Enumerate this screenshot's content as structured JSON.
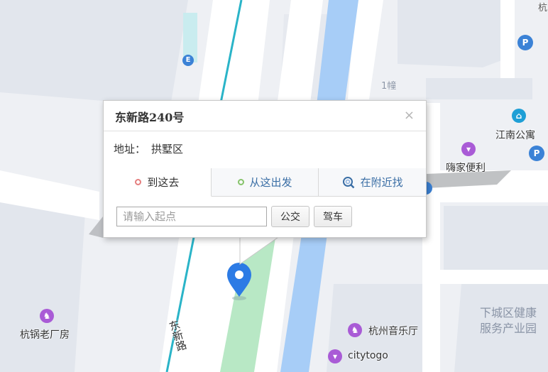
{
  "popup": {
    "title": "东新路240号",
    "close_icon": "×",
    "address_label": "地址：",
    "address_value": "拱墅区",
    "tabs": [
      {
        "label": "到这去",
        "icon": "red-circle",
        "color": "#e57f7f"
      },
      {
        "label": "从这出发",
        "icon": "green-circle",
        "color": "#86c36a"
      },
      {
        "label": "在附近找",
        "icon": "nearby-search-icon",
        "color": "#3a6ea5"
      }
    ],
    "start_placeholder": "请输入起点",
    "transit_button": "公交",
    "drive_button": "驾车"
  },
  "map": {
    "road_label": "东新路",
    "poi": [
      {
        "name": "江南公寓",
        "icon": "building-icon",
        "color": "#1e9fd6"
      },
      {
        "name": "嗨家便利",
        "icon": "shopping-bag-icon",
        "color": "#a95bd6"
      },
      {
        "name": "杭锅老厂房",
        "icon": "rocking-horse-icon",
        "color": "#a95bd6"
      },
      {
        "name": "杭州音乐厅",
        "icon": "rocking-horse-icon",
        "color": "#a95bd6"
      },
      {
        "name": "citytogo",
        "icon": "shopping-bag-icon",
        "color": "#a95bd6"
      }
    ],
    "area_label_line1": "下城区健康",
    "area_label_line2": "服务产业园",
    "building_label": "1幢",
    "top_right_label": "杭",
    "parking_icon_label": "P",
    "entrance_icon_label": "E",
    "colors": {
      "river": "#a7cdf7",
      "green": "#b8e8c5",
      "metro": "#2ab4c8",
      "marker": "#2c7be5",
      "road": "#ffffff",
      "building": "#e3e7ee"
    }
  }
}
